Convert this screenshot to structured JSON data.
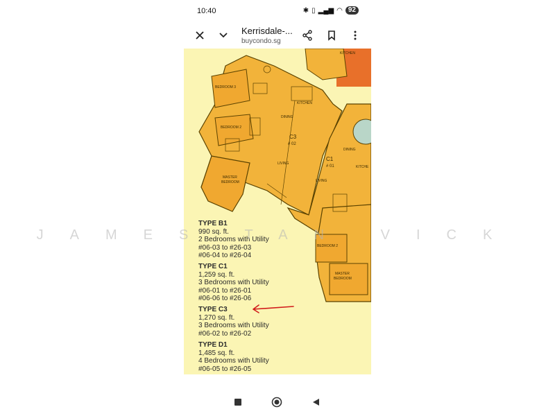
{
  "status_bar": {
    "time": "10:40",
    "battery": "92",
    "icons": [
      "bluetooth-icon",
      "vibrate-icon",
      "signal-icon",
      "wifi-icon",
      "battery-icon"
    ]
  },
  "toolbar": {
    "title": "Kerrisdale-...",
    "domain": "buycondo.sg",
    "close_icon": "close-icon",
    "collapse_icon": "chevron-down-icon",
    "share_icon": "share-icon",
    "bookmark_icon": "bookmark-icon",
    "menu_icon": "more-vert-icon"
  },
  "floor_plan": {
    "rooms": {
      "kitchen_top": "KITCHEN",
      "bedroom3": "BEDROOM 3",
      "kitchen": "KITCHEN",
      "dining": "DINING",
      "bedroom2": "BEDROOM 2",
      "unit_c3": "C3",
      "unit_c3_no": "# 02",
      "living": "LIVING",
      "master_bedroom": "MASTER",
      "master_bedroom2": "BEDROOM",
      "unit_c1": "C1",
      "unit_c1_no": "# 01",
      "living_c1": "LIVING",
      "dining_c1": "DINING",
      "kitchen_c1": "KITCHE",
      "bedroom2_c1": "BEDROOM 2",
      "master_c1": "MASTER",
      "master_c1b": "BEDROOM"
    },
    "colors": {
      "unit_fill": "#f2b33a",
      "wall": "#5a4200",
      "background": "#fbf5b4",
      "neighbor": "#e8702a"
    }
  },
  "watermark": "JAMES TAN VICK",
  "legend": [
    {
      "type": "TYPE B1",
      "area": "990 sq. ft.",
      "desc": "2 Bedrooms with Utility",
      "range1": "#06-03 to #26-03",
      "range2": "#06-04 to #26-04"
    },
    {
      "type": "TYPE C1",
      "area": "1,259 sq. ft.",
      "desc": "3 Bedrooms with Utility",
      "range1": "#06-01 to #26-01",
      "range2": "#06-06 to #26-06"
    },
    {
      "type": "TYPE C3",
      "area": "1,270 sq. ft.",
      "desc": "3 Bedrooms with Utility",
      "range1": "#06-02 to #26-02",
      "range2": ""
    },
    {
      "type": "TYPE D1",
      "area": "1,485 sq. ft.",
      "desc": "4 Bedrooms with Utility",
      "range1": "#06-05 to #26-05",
      "range2": ""
    }
  ],
  "annotation": {
    "color": "#d11a1a"
  },
  "nav_bar": {
    "recents_icon": "square-icon",
    "home_icon": "circle-home-icon",
    "back_icon": "triangle-back-icon"
  }
}
